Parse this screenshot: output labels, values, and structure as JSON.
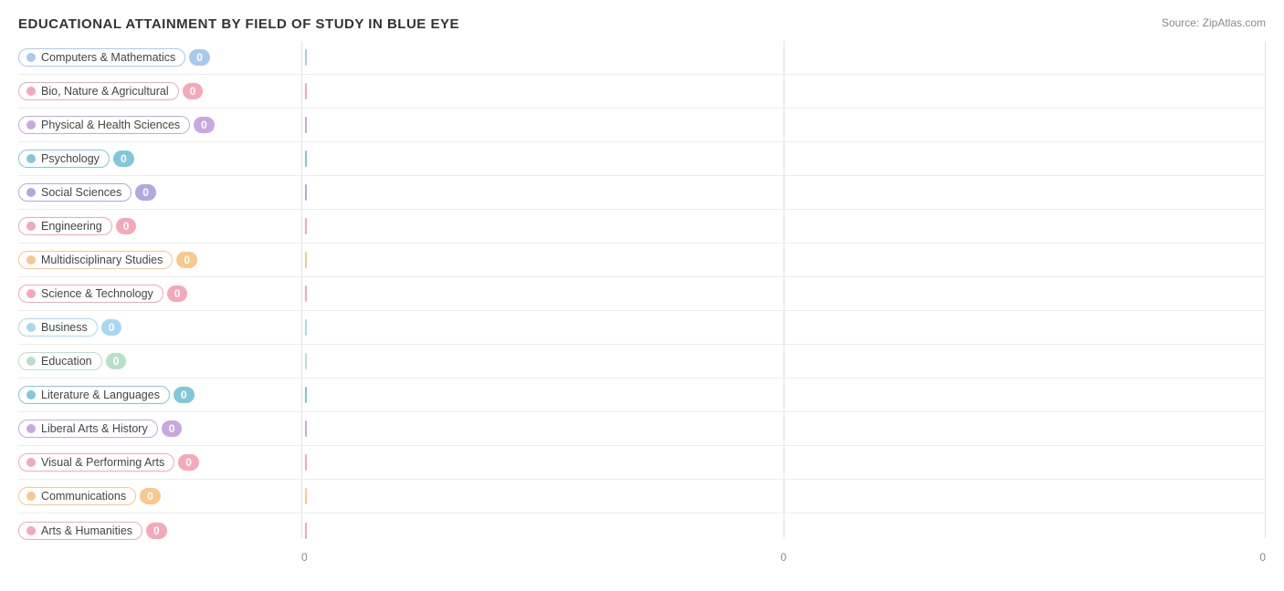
{
  "title": "EDUCATIONAL ATTAINMENT BY FIELD OF STUDY IN BLUE EYE",
  "source": "Source: ZipAtlas.com",
  "xAxisLabels": [
    "0",
    "0",
    "0"
  ],
  "bars": [
    {
      "label": "Computers & Mathematics",
      "value": 0,
      "dotColor": "#a8c8f0",
      "pillBorderColor": "#a8c8f0",
      "valueBgColor": "#a8c8f0",
      "barColor": "#a8c8f0"
    },
    {
      "label": "Bio, Nature & Agricultural",
      "value": 0,
      "dotColor": "#f4a8b8",
      "pillBorderColor": "#f4a8b8",
      "valueBgColor": "#f4a8b8",
      "barColor": "#f4a8b8"
    },
    {
      "label": "Physical & Health Sciences",
      "value": 0,
      "dotColor": "#c8a8e0",
      "pillBorderColor": "#c8a8e0",
      "valueBgColor": "#c8a8e0",
      "barColor": "#c8a8e0"
    },
    {
      "label": "Psychology",
      "value": 0,
      "dotColor": "#80c8d8",
      "pillBorderColor": "#80c8d8",
      "valueBgColor": "#80c8d8",
      "barColor": "#80c8d8"
    },
    {
      "label": "Social Sciences",
      "value": 0,
      "dotColor": "#b0a8e0",
      "pillBorderColor": "#b0a8e0",
      "valueBgColor": "#b0a8e0",
      "barColor": "#b0a8e0"
    },
    {
      "label": "Engineering",
      "value": 0,
      "dotColor": "#f4a8b8",
      "pillBorderColor": "#f4a8b8",
      "valueBgColor": "#f4a8b8",
      "barColor": "#f4a8b8"
    },
    {
      "label": "Multidisciplinary Studies",
      "value": 0,
      "dotColor": "#f8c88c",
      "pillBorderColor": "#f8c88c",
      "valueBgColor": "#f8c88c",
      "barColor": "#f8c88c"
    },
    {
      "label": "Science & Technology",
      "value": 0,
      "dotColor": "#f4a8b8",
      "pillBorderColor": "#f4a8b8",
      "valueBgColor": "#f4a8b8",
      "barColor": "#f4a8b8"
    },
    {
      "label": "Business",
      "value": 0,
      "dotColor": "#a8d8f0",
      "pillBorderColor": "#a8d8f0",
      "valueBgColor": "#a8d8f0",
      "barColor": "#a8d8f0"
    },
    {
      "label": "Education",
      "value": 0,
      "dotColor": "#b8e0c8",
      "pillBorderColor": "#b8e0c8",
      "valueBgColor": "#b8e0c8",
      "barColor": "#b8e0c8"
    },
    {
      "label": "Literature & Languages",
      "value": 0,
      "dotColor": "#80c8d8",
      "pillBorderColor": "#80c8d8",
      "valueBgColor": "#80c8d8",
      "barColor": "#80c8d8"
    },
    {
      "label": "Liberal Arts & History",
      "value": 0,
      "dotColor": "#c8a8e0",
      "pillBorderColor": "#c8a8e0",
      "valueBgColor": "#c8a8e0",
      "barColor": "#c8a8e0"
    },
    {
      "label": "Visual & Performing Arts",
      "value": 0,
      "dotColor": "#f4a8b8",
      "pillBorderColor": "#f4a8b8",
      "valueBgColor": "#f4a8b8",
      "barColor": "#f4a8b8"
    },
    {
      "label": "Communications",
      "value": 0,
      "dotColor": "#f8c88c",
      "pillBorderColor": "#f8c88c",
      "valueBgColor": "#f8c88c",
      "barColor": "#f8c88c"
    },
    {
      "label": "Arts & Humanities",
      "value": 0,
      "dotColor": "#f4a8b8",
      "pillBorderColor": "#f4a8b8",
      "valueBgColor": "#f4a8b8",
      "barColor": "#f4a8b8"
    }
  ]
}
